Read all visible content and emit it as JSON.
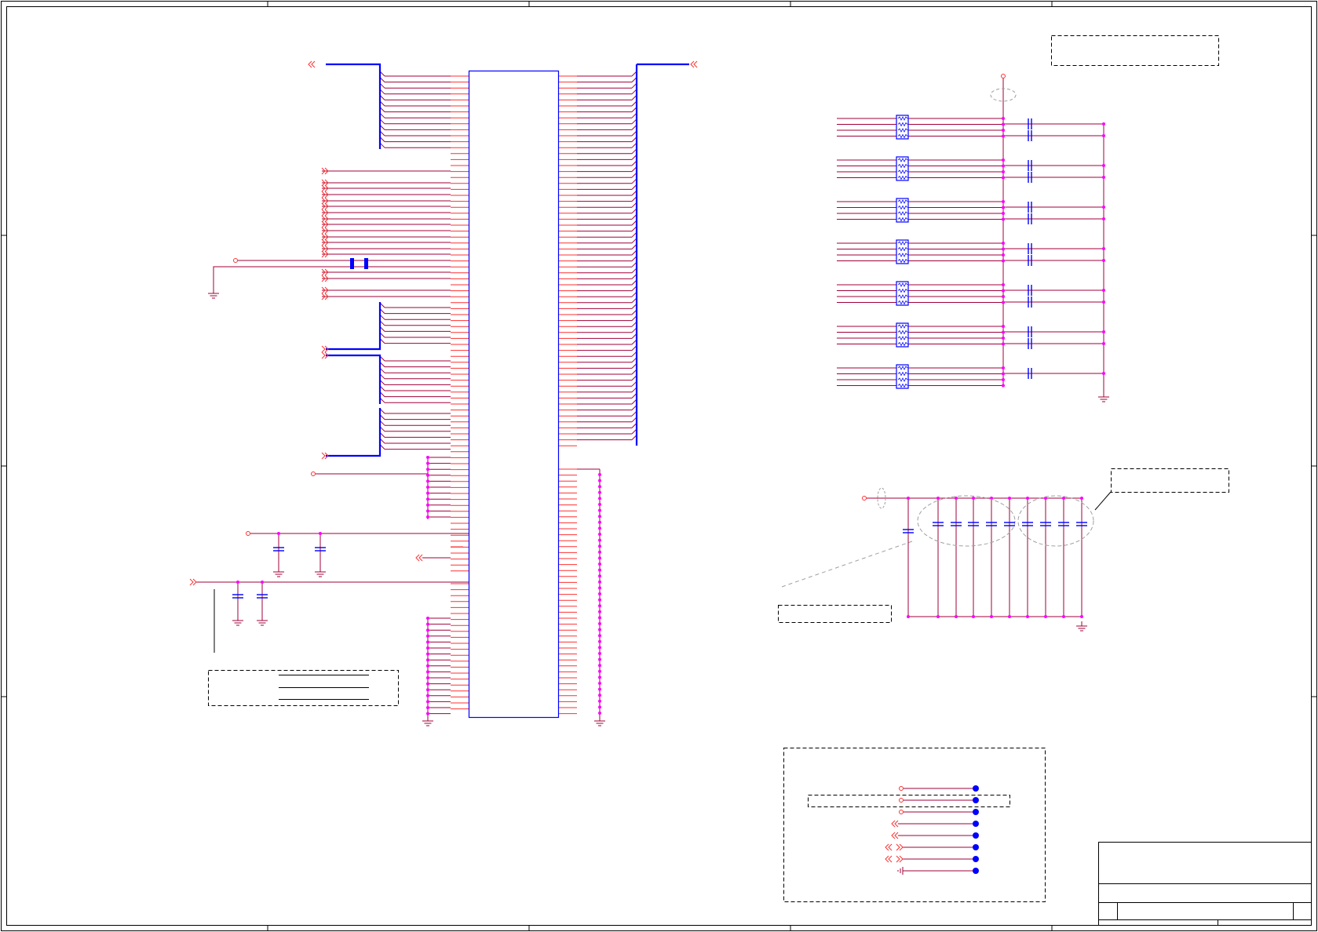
{
  "sheet": {
    "border_color": "#000000",
    "wire_color": "#a0003a",
    "pin_color": "#ff3030",
    "bus_color": "#0000ff",
    "junction_color": "#ff00ff",
    "component_color": "#0000ff",
    "note_border_color": "#000000",
    "leader_color": "#a0a0a0"
  },
  "title_block": {
    "title": "",
    "document_number": "",
    "revision": ""
  },
  "notes": {
    "top_right": "",
    "mid_right": "",
    "mid_left_cap": "",
    "bottom_left": "",
    "bottom_right_group": ""
  }
}
